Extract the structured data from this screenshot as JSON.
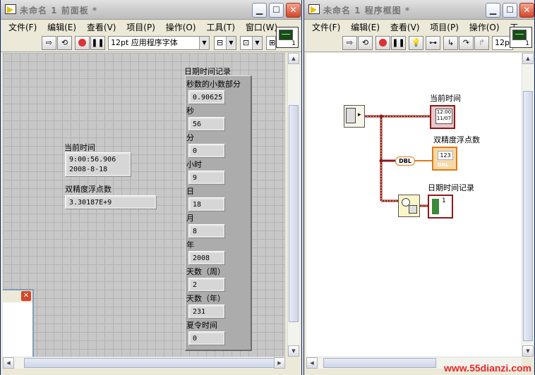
{
  "front_panel": {
    "title": "未命名 1 前面板 *",
    "menu": [
      "文件(F)",
      "编辑(E)",
      "查看(V)",
      "项目(P)",
      "操作(O)",
      "工具(T)",
      "窗口(W)"
    ],
    "font_select": "12pt 应用程序字体",
    "help_number": "1",
    "indicators": {
      "current_time": {
        "label": "当前时间",
        "line1": "9:00:56.906",
        "line2": "2008-8-18"
      },
      "double": {
        "label": "双精度浮点数",
        "value": "3.30187E+9"
      }
    },
    "cluster": {
      "label": "日期时间记录",
      "fields": [
        {
          "label": "秒数的小数部分",
          "value": "0.90625"
        },
        {
          "label": "秒",
          "value": "56"
        },
        {
          "label": "分",
          "value": "0"
        },
        {
          "label": "小时",
          "value": "9"
        },
        {
          "label": "日",
          "value": "18"
        },
        {
          "label": "月",
          "value": "8"
        },
        {
          "label": "年",
          "value": "2008"
        },
        {
          "label": "天数（周）",
          "value": "2"
        },
        {
          "label": "天数（年）",
          "value": "231"
        },
        {
          "label": "夏令时间",
          "value": "0"
        }
      ]
    }
  },
  "block_diagram": {
    "title": "未命名 1 程序框图 *",
    "menu": [
      "文件(F)",
      "编辑(E)",
      "查看(V)",
      "项目(P)",
      "操作(O)",
      "工"
    ],
    "font_select": "12p",
    "help_number": "1",
    "labels": {
      "current_time": "当前时间",
      "double": "双精度浮点数",
      "record": "日期时间记录"
    },
    "terminal_text": {
      "time_top": "12:00",
      "time_bottom": "11/07",
      "dbl": "DBL",
      "num": "123",
      "dbl_small": "DBL",
      "cluster_num": "1"
    }
  },
  "watermark": "www.55dianzi.com",
  "colors": {
    "wire_timestamp": "#8b1a1a",
    "wire_dbl": "#e07a16",
    "cluster_wire": "#8b1a1a"
  }
}
